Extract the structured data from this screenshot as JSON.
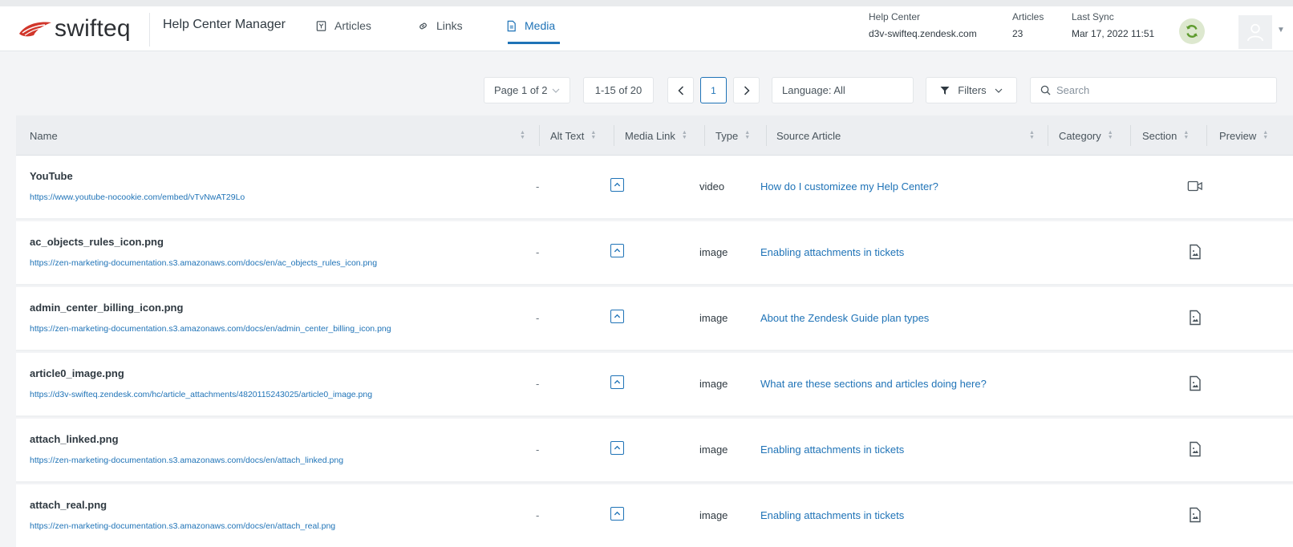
{
  "header": {
    "logo_text": "swifteq",
    "app_title": "Help Center Manager",
    "nav": [
      {
        "label": "Articles",
        "icon": "article-icon",
        "active": false
      },
      {
        "label": "Links",
        "icon": "link-icon",
        "active": false
      },
      {
        "label": "Media",
        "icon": "media-file-icon",
        "active": true
      }
    ],
    "help_center_label": "Help Center",
    "help_center_value": "d3v-swifteq.zendesk.com",
    "articles_label": "Articles",
    "articles_value": "23",
    "last_sync_label": "Last Sync",
    "last_sync_value": "Mar 17, 2022 11:51",
    "sync_icon": "sync-icon",
    "avatar_icon": "user-icon"
  },
  "toolbar": {
    "page_select": "Page 1 of 2",
    "range": "1-15 of 20",
    "prev": "‹",
    "current_page": "1",
    "next": "›",
    "language": "Language: All",
    "filters": "Filters",
    "search_placeholder": "Search"
  },
  "table": {
    "columns": [
      "Name",
      "Alt Text",
      "Media Link",
      "Type",
      "Source Article",
      "Category",
      "Section",
      "Preview"
    ],
    "rows": [
      {
        "name": "YouTube",
        "url": "https://www.youtube-nocookie.com/embed/vTvNwAT29Lo",
        "alt": "-",
        "type": "video",
        "article": "How do I customizee my Help Center?",
        "preview_icon": "video-icon"
      },
      {
        "name": "ac_objects_rules_icon.png",
        "url": "https://zen-marketing-documentation.s3.amazonaws.com/docs/en/ac_objects_rules_icon.png",
        "alt": "-",
        "type": "image",
        "article": "Enabling attachments in tickets",
        "preview_icon": "image-file-icon"
      },
      {
        "name": "admin_center_billing_icon.png",
        "url": "https://zen-marketing-documentation.s3.amazonaws.com/docs/en/admin_center_billing_icon.png",
        "alt": "-",
        "type": "image",
        "article": "About the Zendesk Guide plan types",
        "preview_icon": "image-file-icon"
      },
      {
        "name": "article0_image.png",
        "url": "https://d3v-swifteq.zendesk.com/hc/article_attachments/4820115243025/article0_image.png",
        "alt": "-",
        "type": "image",
        "article": "What are these sections and articles doing here?",
        "preview_icon": "image-file-icon"
      },
      {
        "name": "attach_linked.png",
        "url": "https://zen-marketing-documentation.s3.amazonaws.com/docs/en/attach_linked.png",
        "alt": "-",
        "type": "image",
        "article": "Enabling attachments in tickets",
        "preview_icon": "image-file-icon"
      },
      {
        "name": "attach_real.png",
        "url": "https://zen-marketing-documentation.s3.amazonaws.com/docs/en/attach_real.png",
        "alt": "-",
        "type": "image",
        "article": "Enabling attachments in tickets",
        "preview_icon": "image-file-icon"
      }
    ]
  },
  "colors": {
    "accent": "#1f73b7",
    "brand": "#d1362b",
    "sync": "#5e9b2e"
  }
}
